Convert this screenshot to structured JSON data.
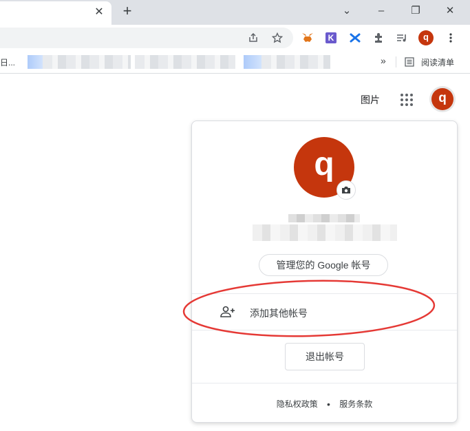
{
  "tabstrip": {
    "close_glyph": "✕",
    "new_tab_glyph": "+",
    "controls": {
      "collapse": "⌄",
      "minimize": "–",
      "restore": "❐",
      "close": "✕"
    }
  },
  "toolbar": {
    "profile_initial": "q",
    "extension_k_label": "K",
    "icons": [
      "share-icon",
      "star-icon",
      "metamask-icon",
      "kiwi-icon",
      "extension-icon",
      "puzzle-icon",
      "media-icon",
      "menu-icon"
    ]
  },
  "bookmarks": {
    "first_item": "日...",
    "overflow": "»",
    "reading_list": "阅读清单"
  },
  "google_header": {
    "images_link": "图片",
    "avatar_initial": "q"
  },
  "account_panel": {
    "avatar_initial": "q",
    "manage_button": "管理您的 Google 帐号",
    "add_account": "添加其他帐号",
    "sign_out": "退出帐号",
    "privacy": "隐私权政策",
    "separator": "•",
    "terms": "服务条款"
  },
  "colors": {
    "avatar": "#c5360d",
    "annotation": "#e53935"
  }
}
